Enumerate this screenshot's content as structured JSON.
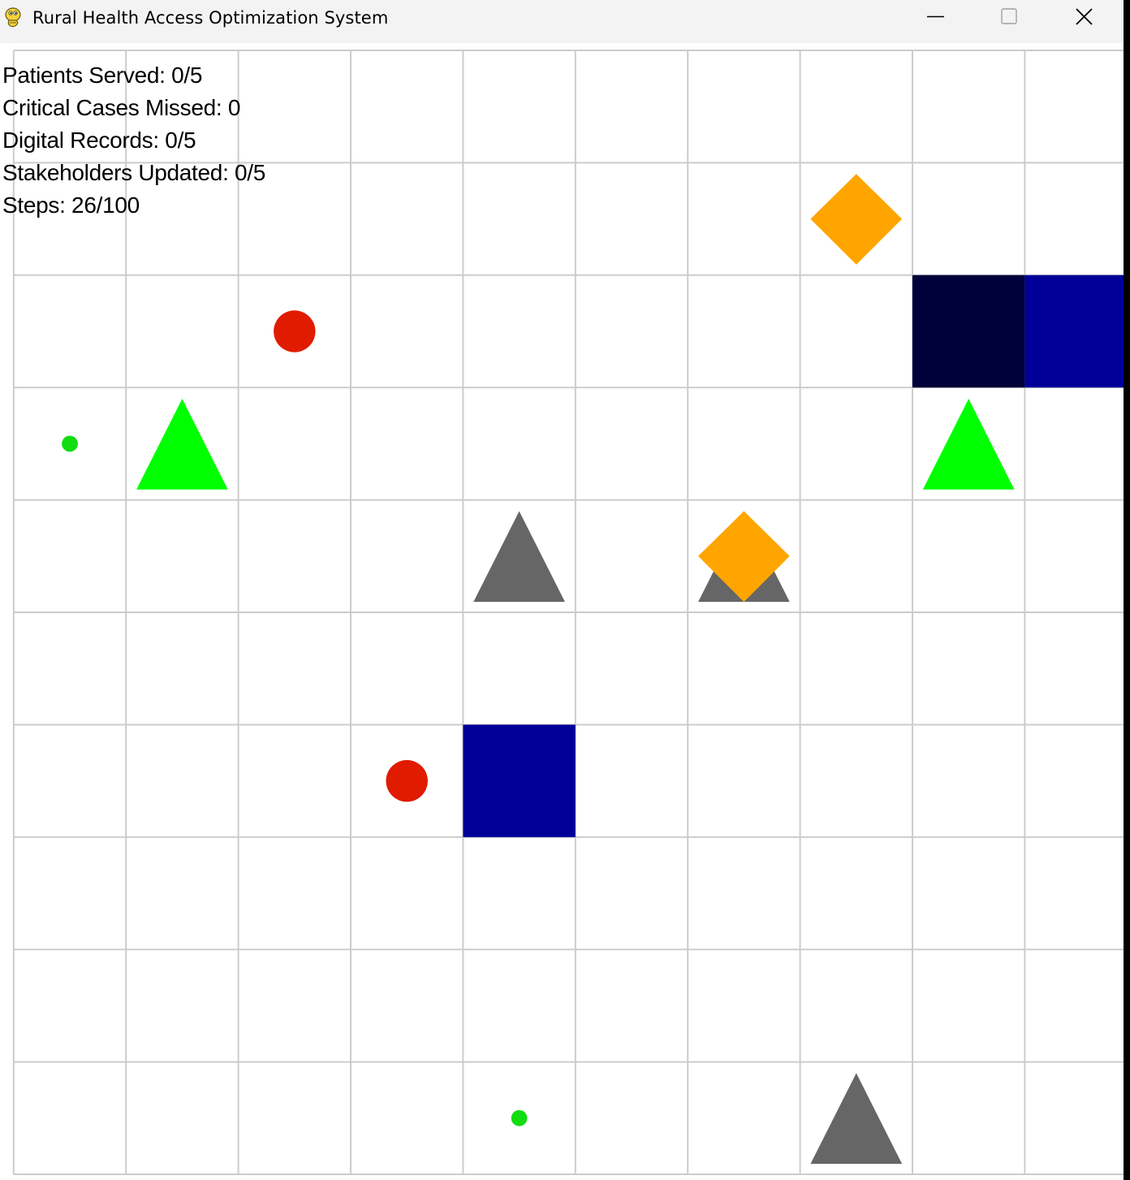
{
  "window": {
    "title": "Rural Health Access Optimization System",
    "app_icon": "pygame-snake-icon",
    "buttons": [
      {
        "name": "minimize-button",
        "icon": "minimize-icon"
      },
      {
        "name": "maximize-button",
        "icon": "maximize-icon"
      },
      {
        "name": "close-button",
        "icon": "close-icon"
      }
    ]
  },
  "hud": {
    "patients_served": "Patients Served: 0/5",
    "critical_missed": "Critical Cases Missed: 0",
    "digital_records": "Digital Records: 0/5",
    "stakeholders_updated": "Stakeholders Updated: 0/5",
    "steps": "Steps: 26/100"
  },
  "grid": {
    "columns": 10,
    "rows": 10,
    "line_color": "#cccccc",
    "background": "#ffffff"
  },
  "colors": {
    "agent": "#00003a",
    "clinic": "#000099",
    "critical_patient": "#e01b00",
    "minor_patient": "#11dd11",
    "stakeholder": "#00ff00",
    "obstacle": "#666666",
    "records_station": "#ffa500"
  },
  "entities": [
    {
      "type": "agent",
      "col": 8,
      "row": 2
    },
    {
      "type": "clinic",
      "col": 9,
      "row": 2
    },
    {
      "type": "clinic",
      "col": 4,
      "row": 6
    },
    {
      "type": "critical_patient",
      "col": 2,
      "row": 2
    },
    {
      "type": "critical_patient",
      "col": 3,
      "row": 6
    },
    {
      "type": "minor_patient",
      "col": 0,
      "row": 3
    },
    {
      "type": "minor_patient",
      "col": 4,
      "row": 9
    },
    {
      "type": "stakeholder",
      "col": 1,
      "row": 3
    },
    {
      "type": "stakeholder",
      "col": 8,
      "row": 3
    },
    {
      "type": "obstacle",
      "col": 4,
      "row": 4
    },
    {
      "type": "obstacle",
      "col": 6,
      "row": 4
    },
    {
      "type": "obstacle",
      "col": 7,
      "row": 9
    },
    {
      "type": "records_station",
      "col": 7,
      "row": 1
    },
    {
      "type": "records_station",
      "col": 6,
      "row": 4
    }
  ]
}
